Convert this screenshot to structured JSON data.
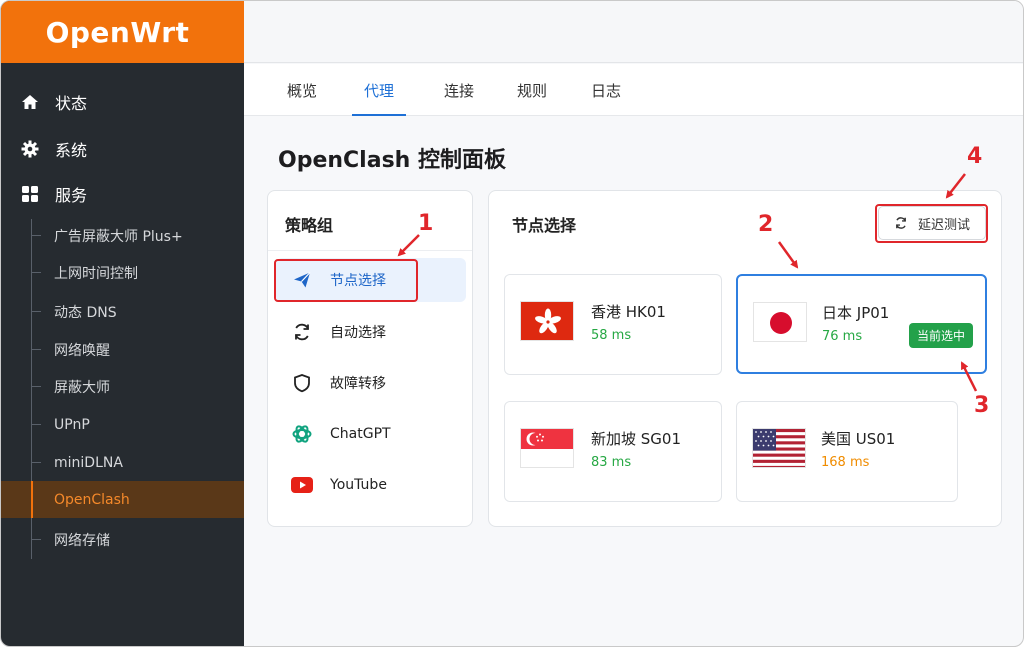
{
  "brand": "OpenWrt",
  "sidebar": {
    "top_items": [
      {
        "label": "状态",
        "icon": "home-icon"
      },
      {
        "label": "系统",
        "icon": "gear-icon"
      },
      {
        "label": "服务",
        "icon": "grid-icon"
      }
    ],
    "sub_items": [
      {
        "label": "广告屏蔽大师 Plus+"
      },
      {
        "label": "上网时间控制"
      },
      {
        "label": "动态 DNS"
      },
      {
        "label": "网络唤醒"
      },
      {
        "label": "屏蔽大师"
      },
      {
        "label": "UPnP"
      },
      {
        "label": "miniDLNA"
      },
      {
        "label": "OpenClash",
        "active": true
      },
      {
        "label": "网络存储"
      }
    ]
  },
  "tabs": [
    {
      "label": "概览"
    },
    {
      "label": "代理",
      "active": true
    },
    {
      "label": "连接"
    },
    {
      "label": "规则"
    },
    {
      "label": "日志"
    }
  ],
  "page_title": "OpenClash 控制面板",
  "policy_groups": {
    "title": "策略组",
    "items": [
      {
        "label": "节点选择",
        "icon": "send-icon",
        "selected": true
      },
      {
        "label": "自动选择",
        "icon": "refresh-icon"
      },
      {
        "label": "故障转移",
        "icon": "shield-icon"
      },
      {
        "label": "ChatGPT",
        "icon": "chatgpt-icon"
      },
      {
        "label": "YouTube",
        "icon": "youtube-icon"
      }
    ]
  },
  "node_panel": {
    "title": "节点选择",
    "latency_button": "延迟测试",
    "current_badge": "当前选中",
    "nodes": [
      {
        "name": "香港 HK01",
        "latency": "58 ms",
        "flag": "hong-kong-flag-icon"
      },
      {
        "name": "日本 JP01",
        "latency": "76 ms",
        "flag": "japan-flag-icon",
        "current": true
      },
      {
        "name": "新加坡 SG01",
        "latency": "83 ms",
        "flag": "singapore-flag-icon"
      },
      {
        "name": "美国 US01",
        "latency": "168 ms",
        "flag": "usa-flag-icon"
      }
    ]
  },
  "annotations": [
    "1",
    "2",
    "3",
    "4"
  ],
  "colors": {
    "brand_orange": "#f2720c",
    "sidebar_bg": "#262b30",
    "accent_blue": "#1e70d6",
    "annotation_red": "#e0262b",
    "latency_green": "#27a844",
    "latency_orange": "#f08c00",
    "badge_green": "#23a14a"
  }
}
